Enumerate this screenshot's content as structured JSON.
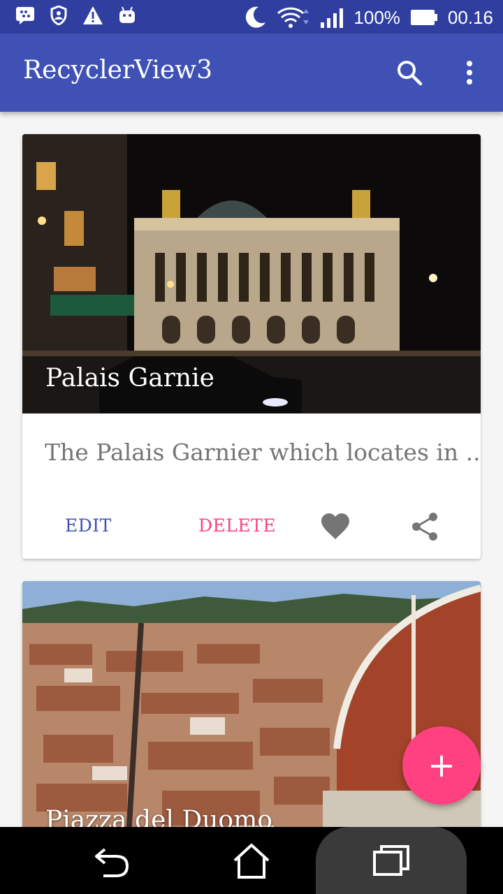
{
  "status_bar": {
    "battery": "100%",
    "time": "00.16"
  },
  "app_bar": {
    "title": "RecyclerView3",
    "icons": [
      "search-icon",
      "more-vert-icon"
    ]
  },
  "cards": [
    {
      "title": "Palais Garnie",
      "description": "The Palais Garnier which locates in ...",
      "edit_label": "EDIT",
      "delete_label": "DELETE",
      "icons": [
        "heart-icon",
        "share-icon"
      ]
    },
    {
      "title": "Piazza del Duomo"
    }
  ],
  "fab": {
    "label": "+"
  },
  "colors": {
    "primary": "#3f51b5",
    "primary_dark": "#303f9f",
    "accent": "#ff4081"
  }
}
